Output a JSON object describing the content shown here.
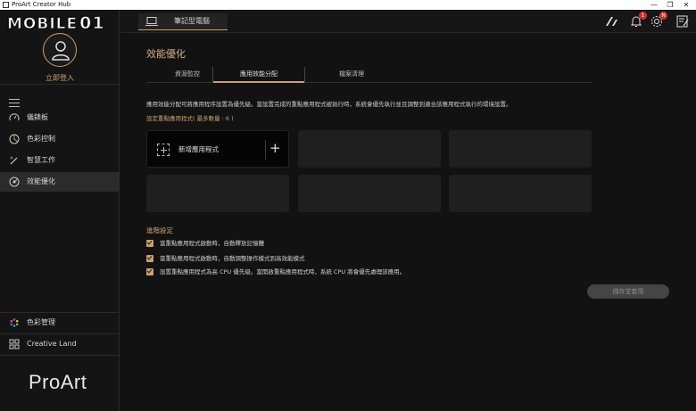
{
  "window": {
    "title": "ProArt Creator Hub",
    "controls": [
      "—",
      "❐",
      "✕"
    ]
  },
  "watermark": {
    "text": "MOBILE",
    "suffix": "01"
  },
  "sidebar": {
    "login_label": "立即登入",
    "items": [
      {
        "label": "儀錶板",
        "icon": "gauge-icon"
      },
      {
        "label": "色彩控制",
        "icon": "color-palette-icon"
      },
      {
        "label": "智慧工作",
        "icon": "magic-wand-icon"
      },
      {
        "label": "效能優化",
        "icon": "performance-icon",
        "active": true
      }
    ],
    "bottom_items": [
      {
        "label": "色彩管理",
        "icon": "color-wheel-icon"
      },
      {
        "label": "Creative Land",
        "icon": "grid-apps-icon"
      }
    ],
    "brand": "ProArt"
  },
  "header": {
    "device_tab": "筆記型電腦",
    "icons": [
      {
        "name": "asus-logo-icon"
      },
      {
        "name": "bell-icon",
        "badge": "1"
      },
      {
        "name": "gear-icon",
        "badge": "N"
      },
      {
        "name": "feedback-icon"
      }
    ]
  },
  "main": {
    "title": "效能優化",
    "tabs": [
      {
        "label": "資源監控"
      },
      {
        "label": "應用效能分配",
        "active": true
      },
      {
        "label": "檔案清理"
      }
    ],
    "description": "應用效能分配可將應用程序設置為優先級。當設置完成的重點應用程式被執行時，系統會優先執行並且調整到適合該應用程式執行的環境設置。",
    "slots_heading": "設定重點應用程式( 最多數量 : 6 )",
    "add_app_label": "新增應用程式",
    "advanced": {
      "title": "進階設定",
      "options": [
        {
          "label": "當重點應用程式啟動時，自動釋放記憶體",
          "checked": true
        },
        {
          "label": "當重點應用程式啟動時，自動調整操作模式到高效能模式",
          "checked": true
        },
        {
          "label": "設置重點應用程式為高 CPU 優先級。當開啟重點應用程式時，系統 CPU 將會優先處理該應用。",
          "checked": true
        }
      ]
    },
    "save_button": "儲存並套用"
  },
  "colors": {
    "accent": "#c9a06b",
    "background": "#121212",
    "badge": "#e02828"
  }
}
